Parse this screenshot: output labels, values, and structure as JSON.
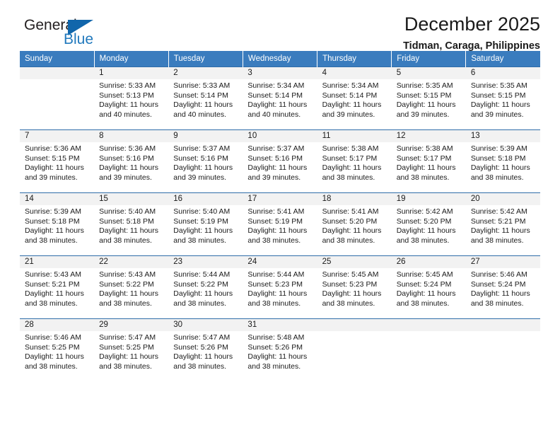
{
  "brand": {
    "name_top": "General",
    "name_bottom": "Blue",
    "triangle_color": "#1166ab",
    "blue_text_color": "#2179bd"
  },
  "header": {
    "title": "December 2025",
    "subtitle": "Tidman, Caraga, Philippines"
  },
  "calendar": {
    "header_bg": "#3a7cbe",
    "daynum_bg": "#f2f2f2",
    "row_border_color": "#2f6da9",
    "weekday_labels": [
      "Sunday",
      "Monday",
      "Tuesday",
      "Wednesday",
      "Thursday",
      "Friday",
      "Saturday"
    ],
    "weeks": [
      [
        {
          "day": "",
          "sunrise": "",
          "sunset": "",
          "daylight": ""
        },
        {
          "day": "1",
          "sunrise": "Sunrise: 5:33 AM",
          "sunset": "Sunset: 5:13 PM",
          "daylight": "Daylight: 11 hours and 40 minutes."
        },
        {
          "day": "2",
          "sunrise": "Sunrise: 5:33 AM",
          "sunset": "Sunset: 5:14 PM",
          "daylight": "Daylight: 11 hours and 40 minutes."
        },
        {
          "day": "3",
          "sunrise": "Sunrise: 5:34 AM",
          "sunset": "Sunset: 5:14 PM",
          "daylight": "Daylight: 11 hours and 40 minutes."
        },
        {
          "day": "4",
          "sunrise": "Sunrise: 5:34 AM",
          "sunset": "Sunset: 5:14 PM",
          "daylight": "Daylight: 11 hours and 39 minutes."
        },
        {
          "day": "5",
          "sunrise": "Sunrise: 5:35 AM",
          "sunset": "Sunset: 5:15 PM",
          "daylight": "Daylight: 11 hours and 39 minutes."
        },
        {
          "day": "6",
          "sunrise": "Sunrise: 5:35 AM",
          "sunset": "Sunset: 5:15 PM",
          "daylight": "Daylight: 11 hours and 39 minutes."
        }
      ],
      [
        {
          "day": "7",
          "sunrise": "Sunrise: 5:36 AM",
          "sunset": "Sunset: 5:15 PM",
          "daylight": "Daylight: 11 hours and 39 minutes."
        },
        {
          "day": "8",
          "sunrise": "Sunrise: 5:36 AM",
          "sunset": "Sunset: 5:16 PM",
          "daylight": "Daylight: 11 hours and 39 minutes."
        },
        {
          "day": "9",
          "sunrise": "Sunrise: 5:37 AM",
          "sunset": "Sunset: 5:16 PM",
          "daylight": "Daylight: 11 hours and 39 minutes."
        },
        {
          "day": "10",
          "sunrise": "Sunrise: 5:37 AM",
          "sunset": "Sunset: 5:16 PM",
          "daylight": "Daylight: 11 hours and 39 minutes."
        },
        {
          "day": "11",
          "sunrise": "Sunrise: 5:38 AM",
          "sunset": "Sunset: 5:17 PM",
          "daylight": "Daylight: 11 hours and 38 minutes."
        },
        {
          "day": "12",
          "sunrise": "Sunrise: 5:38 AM",
          "sunset": "Sunset: 5:17 PM",
          "daylight": "Daylight: 11 hours and 38 minutes."
        },
        {
          "day": "13",
          "sunrise": "Sunrise: 5:39 AM",
          "sunset": "Sunset: 5:18 PM",
          "daylight": "Daylight: 11 hours and 38 minutes."
        }
      ],
      [
        {
          "day": "14",
          "sunrise": "Sunrise: 5:39 AM",
          "sunset": "Sunset: 5:18 PM",
          "daylight": "Daylight: 11 hours and 38 minutes."
        },
        {
          "day": "15",
          "sunrise": "Sunrise: 5:40 AM",
          "sunset": "Sunset: 5:18 PM",
          "daylight": "Daylight: 11 hours and 38 minutes."
        },
        {
          "day": "16",
          "sunrise": "Sunrise: 5:40 AM",
          "sunset": "Sunset: 5:19 PM",
          "daylight": "Daylight: 11 hours and 38 minutes."
        },
        {
          "day": "17",
          "sunrise": "Sunrise: 5:41 AM",
          "sunset": "Sunset: 5:19 PM",
          "daylight": "Daylight: 11 hours and 38 minutes."
        },
        {
          "day": "18",
          "sunrise": "Sunrise: 5:41 AM",
          "sunset": "Sunset: 5:20 PM",
          "daylight": "Daylight: 11 hours and 38 minutes."
        },
        {
          "day": "19",
          "sunrise": "Sunrise: 5:42 AM",
          "sunset": "Sunset: 5:20 PM",
          "daylight": "Daylight: 11 hours and 38 minutes."
        },
        {
          "day": "20",
          "sunrise": "Sunrise: 5:42 AM",
          "sunset": "Sunset: 5:21 PM",
          "daylight": "Daylight: 11 hours and 38 minutes."
        }
      ],
      [
        {
          "day": "21",
          "sunrise": "Sunrise: 5:43 AM",
          "sunset": "Sunset: 5:21 PM",
          "daylight": "Daylight: 11 hours and 38 minutes."
        },
        {
          "day": "22",
          "sunrise": "Sunrise: 5:43 AM",
          "sunset": "Sunset: 5:22 PM",
          "daylight": "Daylight: 11 hours and 38 minutes."
        },
        {
          "day": "23",
          "sunrise": "Sunrise: 5:44 AM",
          "sunset": "Sunset: 5:22 PM",
          "daylight": "Daylight: 11 hours and 38 minutes."
        },
        {
          "day": "24",
          "sunrise": "Sunrise: 5:44 AM",
          "sunset": "Sunset: 5:23 PM",
          "daylight": "Daylight: 11 hours and 38 minutes."
        },
        {
          "day": "25",
          "sunrise": "Sunrise: 5:45 AM",
          "sunset": "Sunset: 5:23 PM",
          "daylight": "Daylight: 11 hours and 38 minutes."
        },
        {
          "day": "26",
          "sunrise": "Sunrise: 5:45 AM",
          "sunset": "Sunset: 5:24 PM",
          "daylight": "Daylight: 11 hours and 38 minutes."
        },
        {
          "day": "27",
          "sunrise": "Sunrise: 5:46 AM",
          "sunset": "Sunset: 5:24 PM",
          "daylight": "Daylight: 11 hours and 38 minutes."
        }
      ],
      [
        {
          "day": "28",
          "sunrise": "Sunrise: 5:46 AM",
          "sunset": "Sunset: 5:25 PM",
          "daylight": "Daylight: 11 hours and 38 minutes."
        },
        {
          "day": "29",
          "sunrise": "Sunrise: 5:47 AM",
          "sunset": "Sunset: 5:25 PM",
          "daylight": "Daylight: 11 hours and 38 minutes."
        },
        {
          "day": "30",
          "sunrise": "Sunrise: 5:47 AM",
          "sunset": "Sunset: 5:26 PM",
          "daylight": "Daylight: 11 hours and 38 minutes."
        },
        {
          "day": "31",
          "sunrise": "Sunrise: 5:48 AM",
          "sunset": "Sunset: 5:26 PM",
          "daylight": "Daylight: 11 hours and 38 minutes."
        },
        {
          "day": "",
          "sunrise": "",
          "sunset": "",
          "daylight": ""
        },
        {
          "day": "",
          "sunrise": "",
          "sunset": "",
          "daylight": ""
        },
        {
          "day": "",
          "sunrise": "",
          "sunset": "",
          "daylight": ""
        }
      ]
    ]
  }
}
